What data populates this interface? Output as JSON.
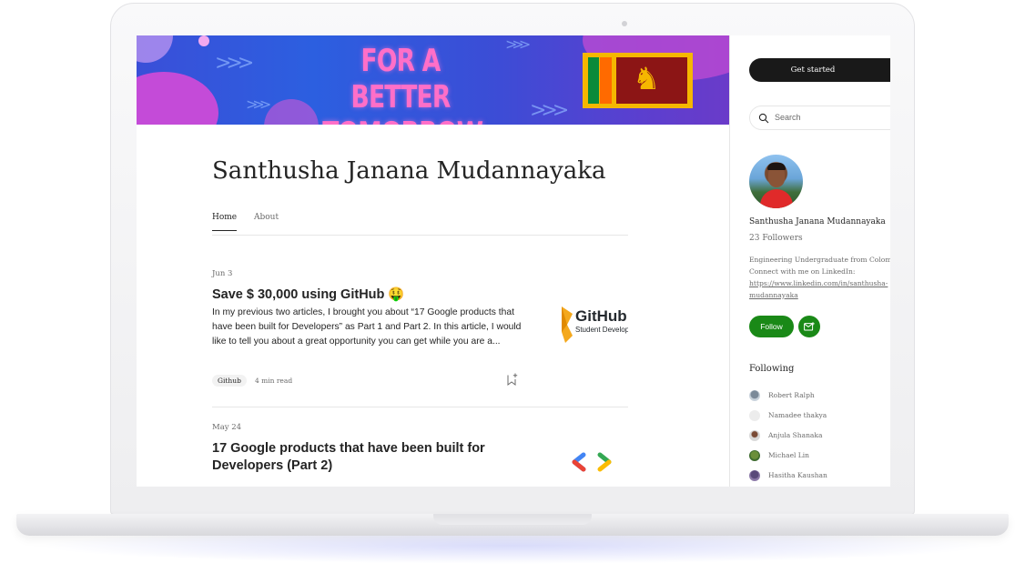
{
  "banner": {
    "line1": "FOR A BETTER",
    "line2": "TOMORROW",
    "chevrons": ">>>"
  },
  "author": {
    "name": "Santhusha Janana Mudannayaka"
  },
  "tabs": [
    {
      "label": "Home"
    },
    {
      "label": "About"
    }
  ],
  "posts": [
    {
      "date": "Jun 3",
      "title": "Save $ 30,000 using GitHub 🤑",
      "excerpt": "In my previous two articles, I brought you about “17 Google products that have been built for Developers” as Part 1 and Part 2. In this article, I would like to tell you about a great opportunity you can get while you are a...",
      "tag": "Github",
      "read_time": "4 min read",
      "thumb_title": "GitHub",
      "thumb_sub": "Student Developer"
    },
    {
      "date": "May 24",
      "title": "17 Google products that have been built for Developers (Part 2)"
    }
  ],
  "sidebar": {
    "get_started": "Get started",
    "search_placeholder": "Search",
    "name": "Santhusha Janana Mudannayaka",
    "followers": "23 Followers",
    "bio_line1": "Engineering Undergraduate from Colombo",
    "bio_line2": "Connect with me on LinkedIn:",
    "bio_link1": "https://www.linkedin.com/in/santhusha-",
    "bio_link2": "mudannayaka",
    "follow": "Follow",
    "following_heading": "Following",
    "following": [
      {
        "name": "Robert Ralph"
      },
      {
        "name": "Namadee thakya"
      },
      {
        "name": "Anjula Shanaka"
      },
      {
        "name": "Michael Lin"
      },
      {
        "name": "Hasitha Kaushan"
      }
    ]
  },
  "colors": {
    "accent_green": "#1a8917",
    "dark_button": "#191919",
    "banner_blue": "#3a4fd8",
    "banner_pink": "#ff6fc8"
  }
}
